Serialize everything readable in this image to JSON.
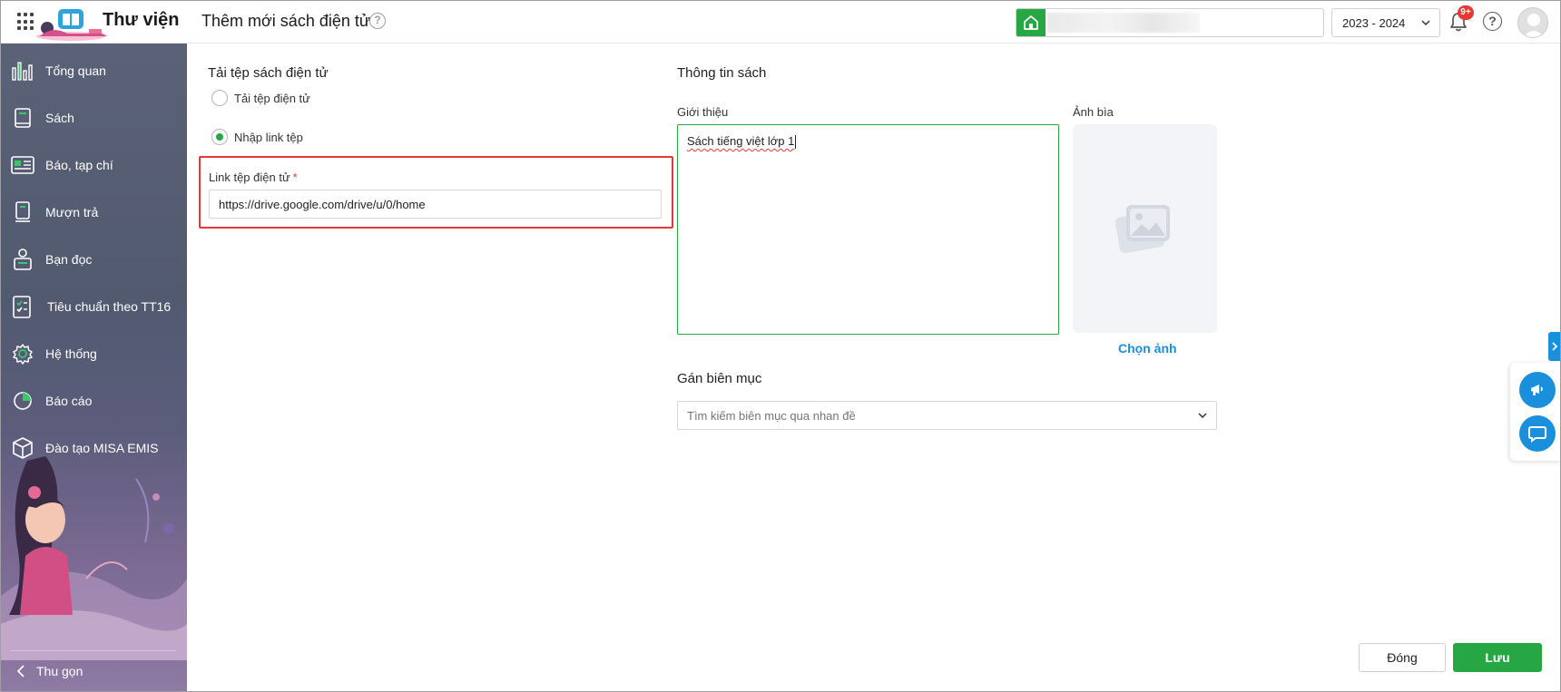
{
  "header": {
    "app_title": "Thư viện",
    "page_title": "Thêm mới sách điện tử",
    "help_symbol": "?",
    "school_year": "2023 - 2024",
    "notification_badge": "9+"
  },
  "sidebar": {
    "items": [
      {
        "label": "Tổng quan",
        "icon": "bar-chart-icon"
      },
      {
        "label": "Sách",
        "icon": "book-icon"
      },
      {
        "label": "Báo, tạp chí",
        "icon": "newspaper-icon"
      },
      {
        "label": "Mượn trả",
        "icon": "borrow-return-icon"
      },
      {
        "label": "Bạn đọc",
        "icon": "reader-icon"
      },
      {
        "label": "Tiêu chuẩn theo TT16",
        "icon": "checklist-icon"
      },
      {
        "label": "Hệ thống",
        "icon": "gear-icon"
      },
      {
        "label": "Báo cáo",
        "icon": "pie-chart-icon"
      },
      {
        "label": "Đào tạo MISA EMIS",
        "icon": "cube-icon"
      }
    ],
    "collapse_label": "Thu gọn"
  },
  "upload": {
    "section_title": "Tải tệp sách điện tử",
    "option_file": "Tải tệp điện tử",
    "option_link": "Nhập link tệp",
    "selected": "link",
    "link_label": "Link tệp điện tử",
    "required_mark": "*",
    "link_value": "https://drive.google.com/drive/u/0/home"
  },
  "book_info": {
    "section_title": "Thông tin sách",
    "intro_label": "Giới thiệu",
    "intro_value": "Sách tiếng việt lớp 1",
    "cover_label": "Ảnh bìa",
    "choose_image": "Chọn ảnh"
  },
  "catalog": {
    "section_title": "Gán biên mục",
    "placeholder": "Tìm kiếm biên mục qua nhan đề"
  },
  "footer": {
    "close_label": "Đóng",
    "save_label": "Lưu"
  },
  "colors": {
    "primary_green": "#27a644",
    "accent_blue": "#1a8fdc",
    "highlight_red": "#e53935"
  }
}
